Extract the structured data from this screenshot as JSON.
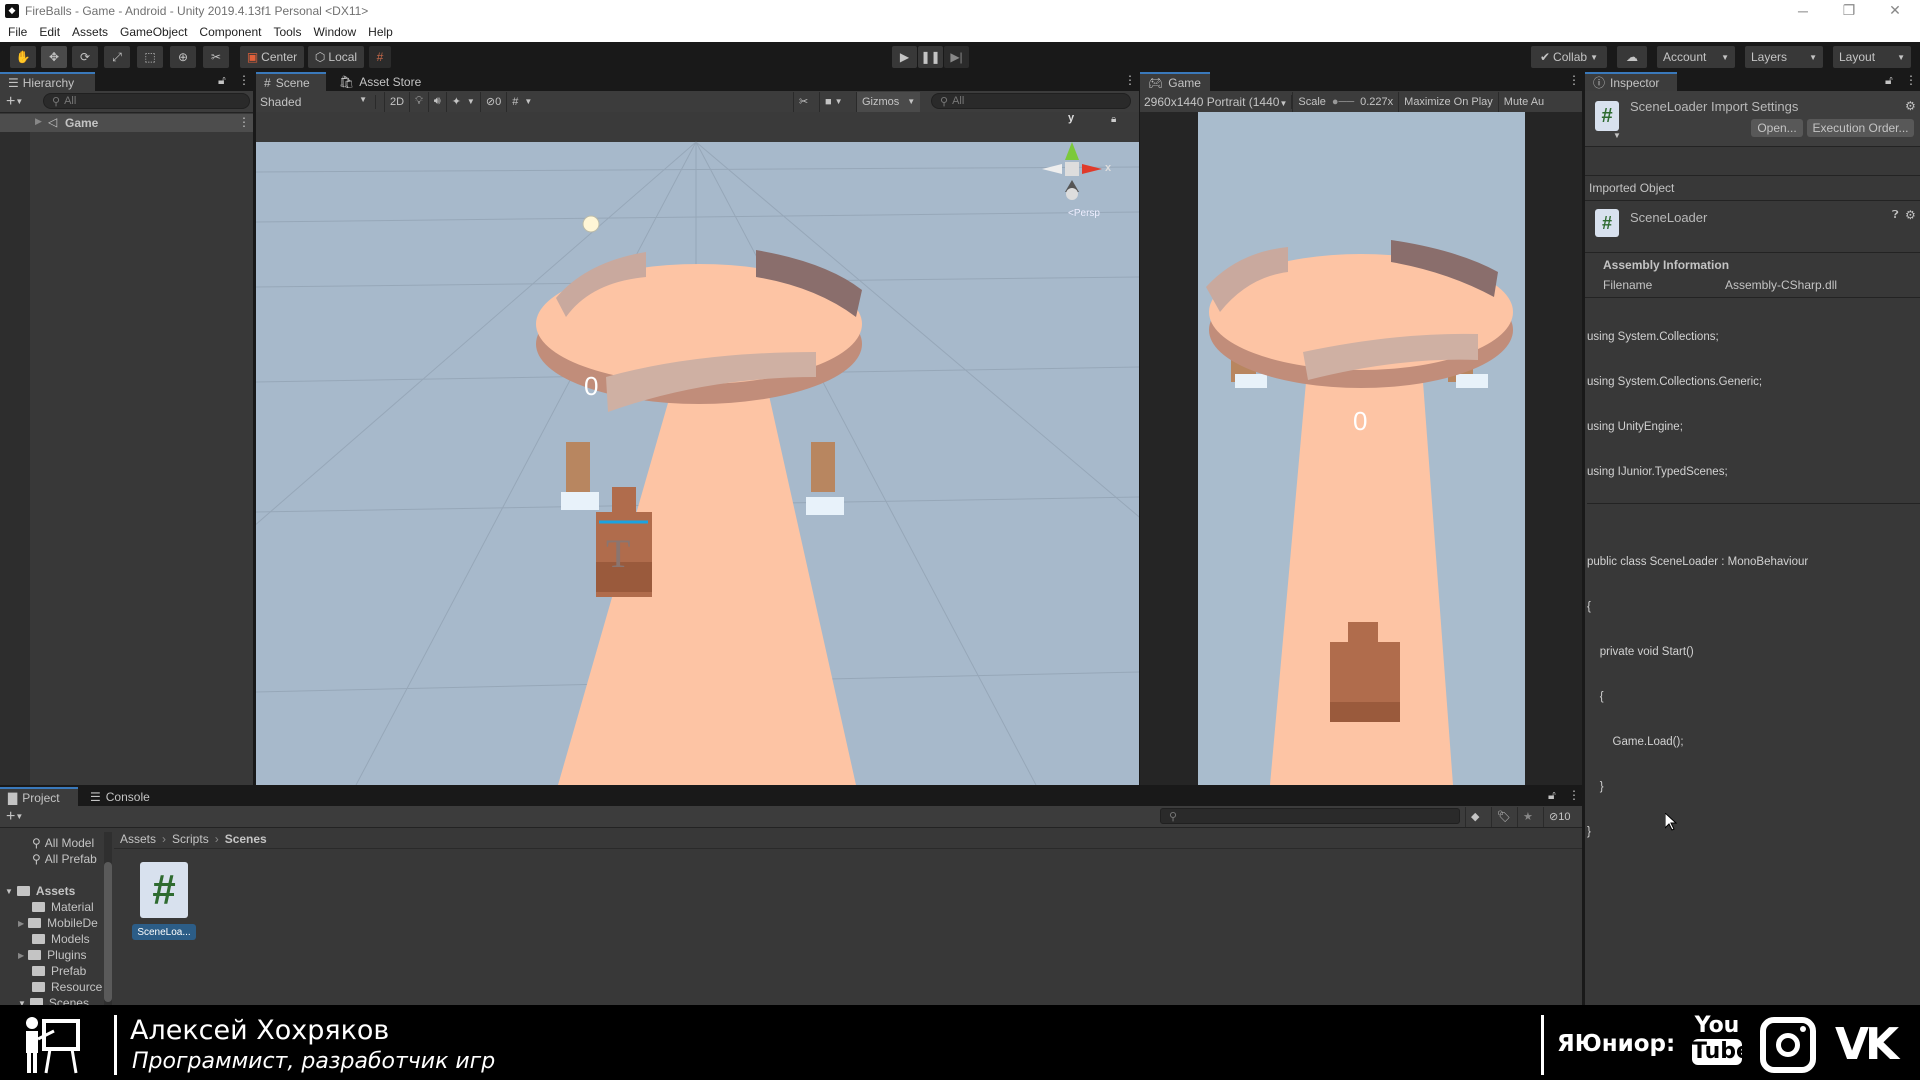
{
  "window": {
    "title": "FireBalls - Game - Android - Unity 2019.4.13f1 Personal <DX11>",
    "controls": [
      "minimize",
      "restore",
      "close"
    ]
  },
  "menu": [
    "File",
    "Edit",
    "Assets",
    "GameObject",
    "Component",
    "Tools",
    "Window",
    "Help"
  ],
  "toolbar": {
    "tools": [
      "hand-tool",
      "move-tool",
      "rotate-tool",
      "scale-tool",
      "rect-tool",
      "transform-tool",
      "custom-tool"
    ],
    "pivot_label": "Center",
    "space_label": "Local",
    "playback": [
      "play",
      "pause",
      "step"
    ],
    "collab_label": "Collab",
    "account_label": "Account",
    "layers_label": "Layers",
    "layout_label": "Layout"
  },
  "hierarchy": {
    "tab_label": "Hierarchy",
    "search_placeholder": "All",
    "items": [
      {
        "label": "Game",
        "expanded": false
      }
    ]
  },
  "scene": {
    "tabs": [
      "Scene",
      "Asset Store"
    ],
    "shading_mode": "Shaded",
    "toggle_2d": "2D",
    "hidden_count": "0",
    "gizmos_label": "Gizmos",
    "search_placeholder": "All",
    "persp_label": "Persp",
    "axis_y": "y",
    "axis_x": "x",
    "score_text": "0"
  },
  "game": {
    "tab_label": "Game",
    "resolution": "2960x1440 Portrait (1440",
    "scale_label": "Scale",
    "scale_value": "0.227x",
    "maximize_label": "Maximize On Play",
    "mute_label": "Mute Au",
    "score_text": "0"
  },
  "inspector": {
    "tab_label": "Inspector",
    "header_title": "SceneLoader Import Settings",
    "open_button": "Open...",
    "execution_order_button": "Execution Order...",
    "imported_object_label": "Imported Object",
    "object_name": "SceneLoader",
    "assembly_info_label": "Assembly Information",
    "filename_label": "Filename",
    "filename_value": "Assembly-CSharp.dll",
    "code_lines": [
      "using System.Collections;",
      "using System.Collections.Generic;",
      "using UnityEngine;",
      "using IJunior.TypedScenes;",
      "",
      "public class SceneLoader : MonoBehaviour",
      "{",
      "    private void Start()",
      "    {",
      "        Game.Load();",
      "    }",
      "}"
    ]
  },
  "project": {
    "tabs": [
      "Project",
      "Console"
    ],
    "favorites": [
      "All Model",
      "All Prefab"
    ],
    "tree": [
      {
        "label": "Assets",
        "level": 0,
        "expanded": true,
        "bold": true
      },
      {
        "label": "Material",
        "level": 1,
        "has_children": false
      },
      {
        "label": "MobileDe",
        "level": 1,
        "has_children": true
      },
      {
        "label": "Models",
        "level": 1,
        "has_children": false
      },
      {
        "label": "Plugins",
        "level": 1,
        "has_children": true
      },
      {
        "label": "Prefab",
        "level": 1,
        "has_children": false
      },
      {
        "label": "Resource",
        "level": 1,
        "has_children": false
      },
      {
        "label": "Scenes",
        "level": 1,
        "has_children": true,
        "expanded": true
      }
    ],
    "breadcrumb": [
      "Assets",
      "Scripts",
      "Scenes"
    ],
    "assets": [
      {
        "label": "SceneLoa...",
        "type": "csharp-script",
        "selected": true
      }
    ],
    "hidden_count": "10"
  },
  "overlay": {
    "name": "Алексей Хохряков",
    "subtitle": "Программист, разработчик игр",
    "brand": "ЯЮниор:",
    "socials": [
      "YouTube",
      "Instagram",
      "VK"
    ]
  }
}
